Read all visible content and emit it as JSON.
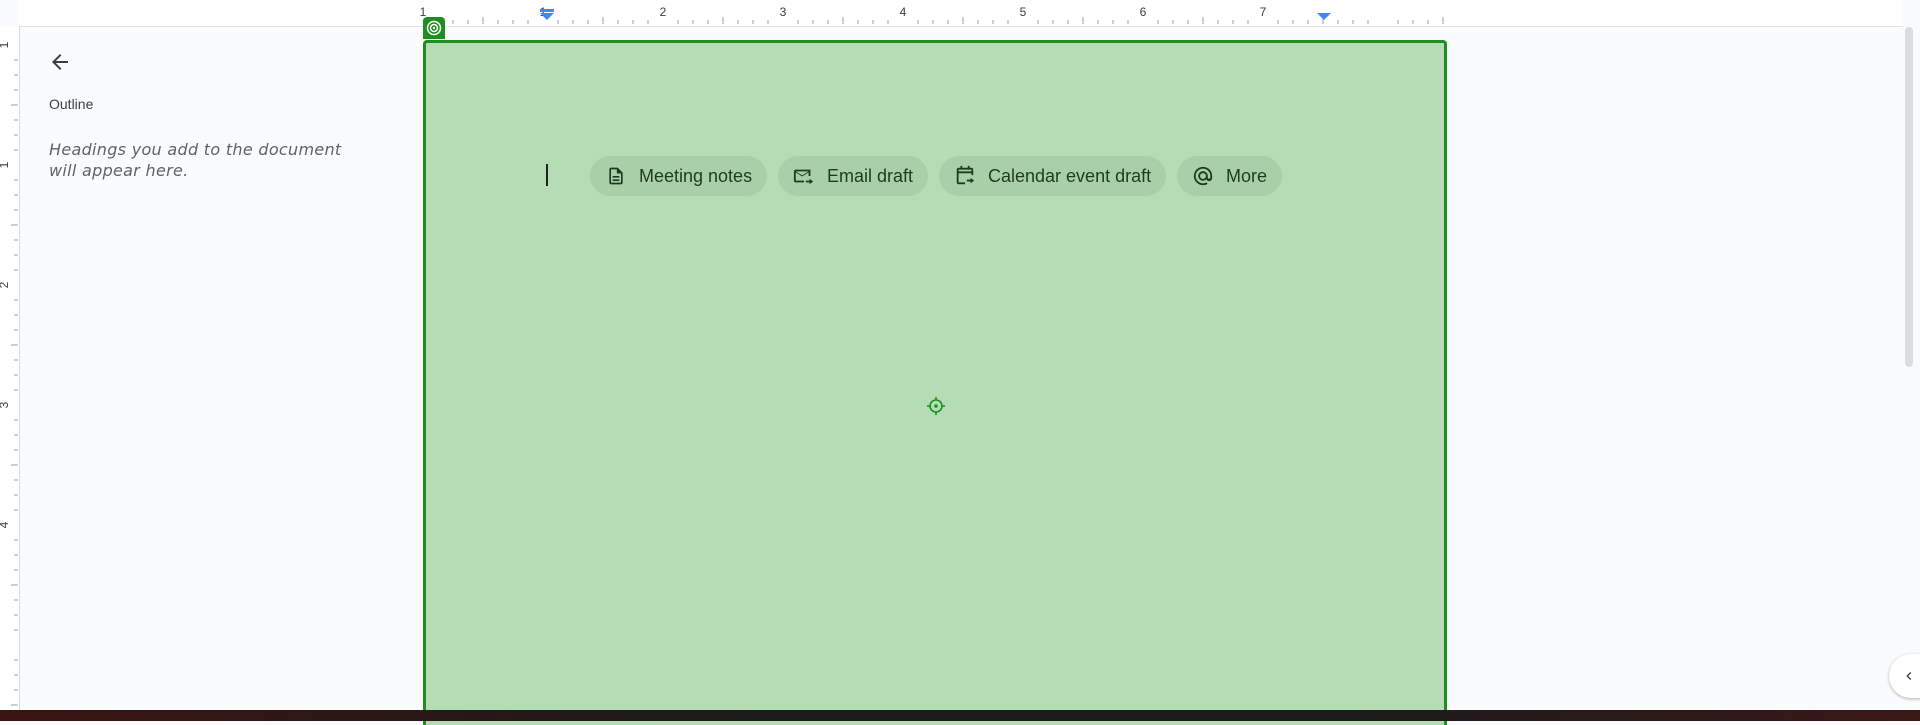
{
  "outline": {
    "title": "Outline",
    "hint": "Headings you add to the document will appear here.",
    "back_icon": "arrow-back-icon"
  },
  "ruler": {
    "horizontal_labels": [
      "1",
      "1",
      "2",
      "3",
      "4",
      "5",
      "6",
      "7"
    ],
    "vertical_labels": [
      "1",
      "1",
      "2",
      "3",
      "4"
    ]
  },
  "chips": [
    {
      "label": "Meeting notes",
      "icon": "document-icon"
    },
    {
      "label": "Email draft",
      "icon": "email-forward-icon"
    },
    {
      "label": "Calendar event draft",
      "icon": "calendar-arrow-icon"
    },
    {
      "label": "More",
      "icon": "at-sign-icon"
    }
  ],
  "colors": {
    "overlay_fill": "#b5ddb5",
    "overlay_border": "#1e8e1e",
    "ruler_marker": "#4285f4"
  }
}
